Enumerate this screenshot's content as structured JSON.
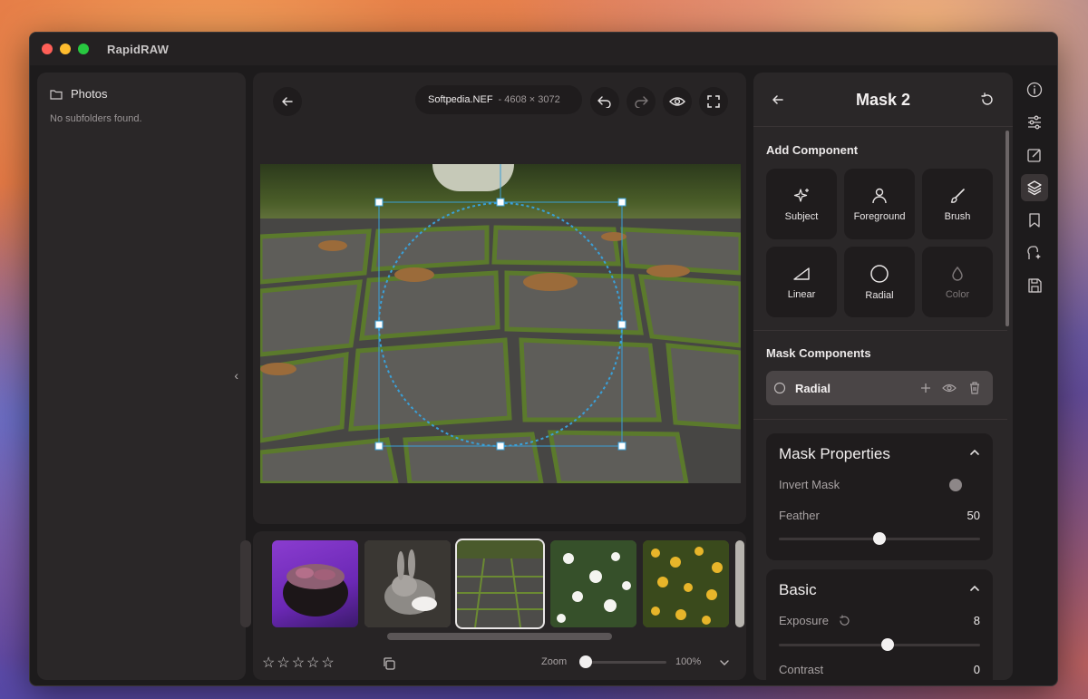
{
  "app": {
    "title": "RapidRAW"
  },
  "folders": {
    "root_label": "Photos",
    "empty_message": "No subfolders found."
  },
  "viewer": {
    "file_name": "Softpedia.NEF",
    "dimensions": "- 4608 × 3072"
  },
  "filmstrip": {
    "rating_stars": 5,
    "zoom_label": "Zoom",
    "zoom_value": "100%",
    "zoom_fraction": 0.0
  },
  "mask_panel": {
    "title": "Mask 2",
    "add_component_label": "Add Component",
    "components": [
      {
        "label": "Subject",
        "icon": "sparkles-icon",
        "enabled": true
      },
      {
        "label": "Foreground",
        "icon": "person-icon",
        "enabled": true
      },
      {
        "label": "Brush",
        "icon": "brush-icon",
        "enabled": true
      },
      {
        "label": "Linear",
        "icon": "linear-gradient-icon",
        "enabled": true
      },
      {
        "label": "Radial",
        "icon": "circle-icon",
        "enabled": true
      },
      {
        "label": "Color",
        "icon": "droplet-icon",
        "enabled": false
      }
    ],
    "mask_components_label": "Mask Components",
    "mask_items": [
      {
        "label": "Radial"
      }
    ],
    "properties": {
      "title": "Mask Properties",
      "invert_label": "Invert Mask",
      "feather_label": "Feather",
      "feather_value": "50",
      "feather_fraction": 0.5
    },
    "basic": {
      "title": "Basic",
      "exposure_label": "Exposure",
      "exposure_value": "8",
      "exposure_fraction": 0.54,
      "contrast_label": "Contrast",
      "contrast_value": "0"
    }
  },
  "rail_icons": [
    "info-icon",
    "adjustments-icon",
    "edit-icon",
    "layers-icon",
    "bookmark-icon",
    "ai-icon",
    "save-icon"
  ],
  "colors": {
    "accent": "#f3f1f1",
    "mask_overlay": "#3aa0d8"
  }
}
